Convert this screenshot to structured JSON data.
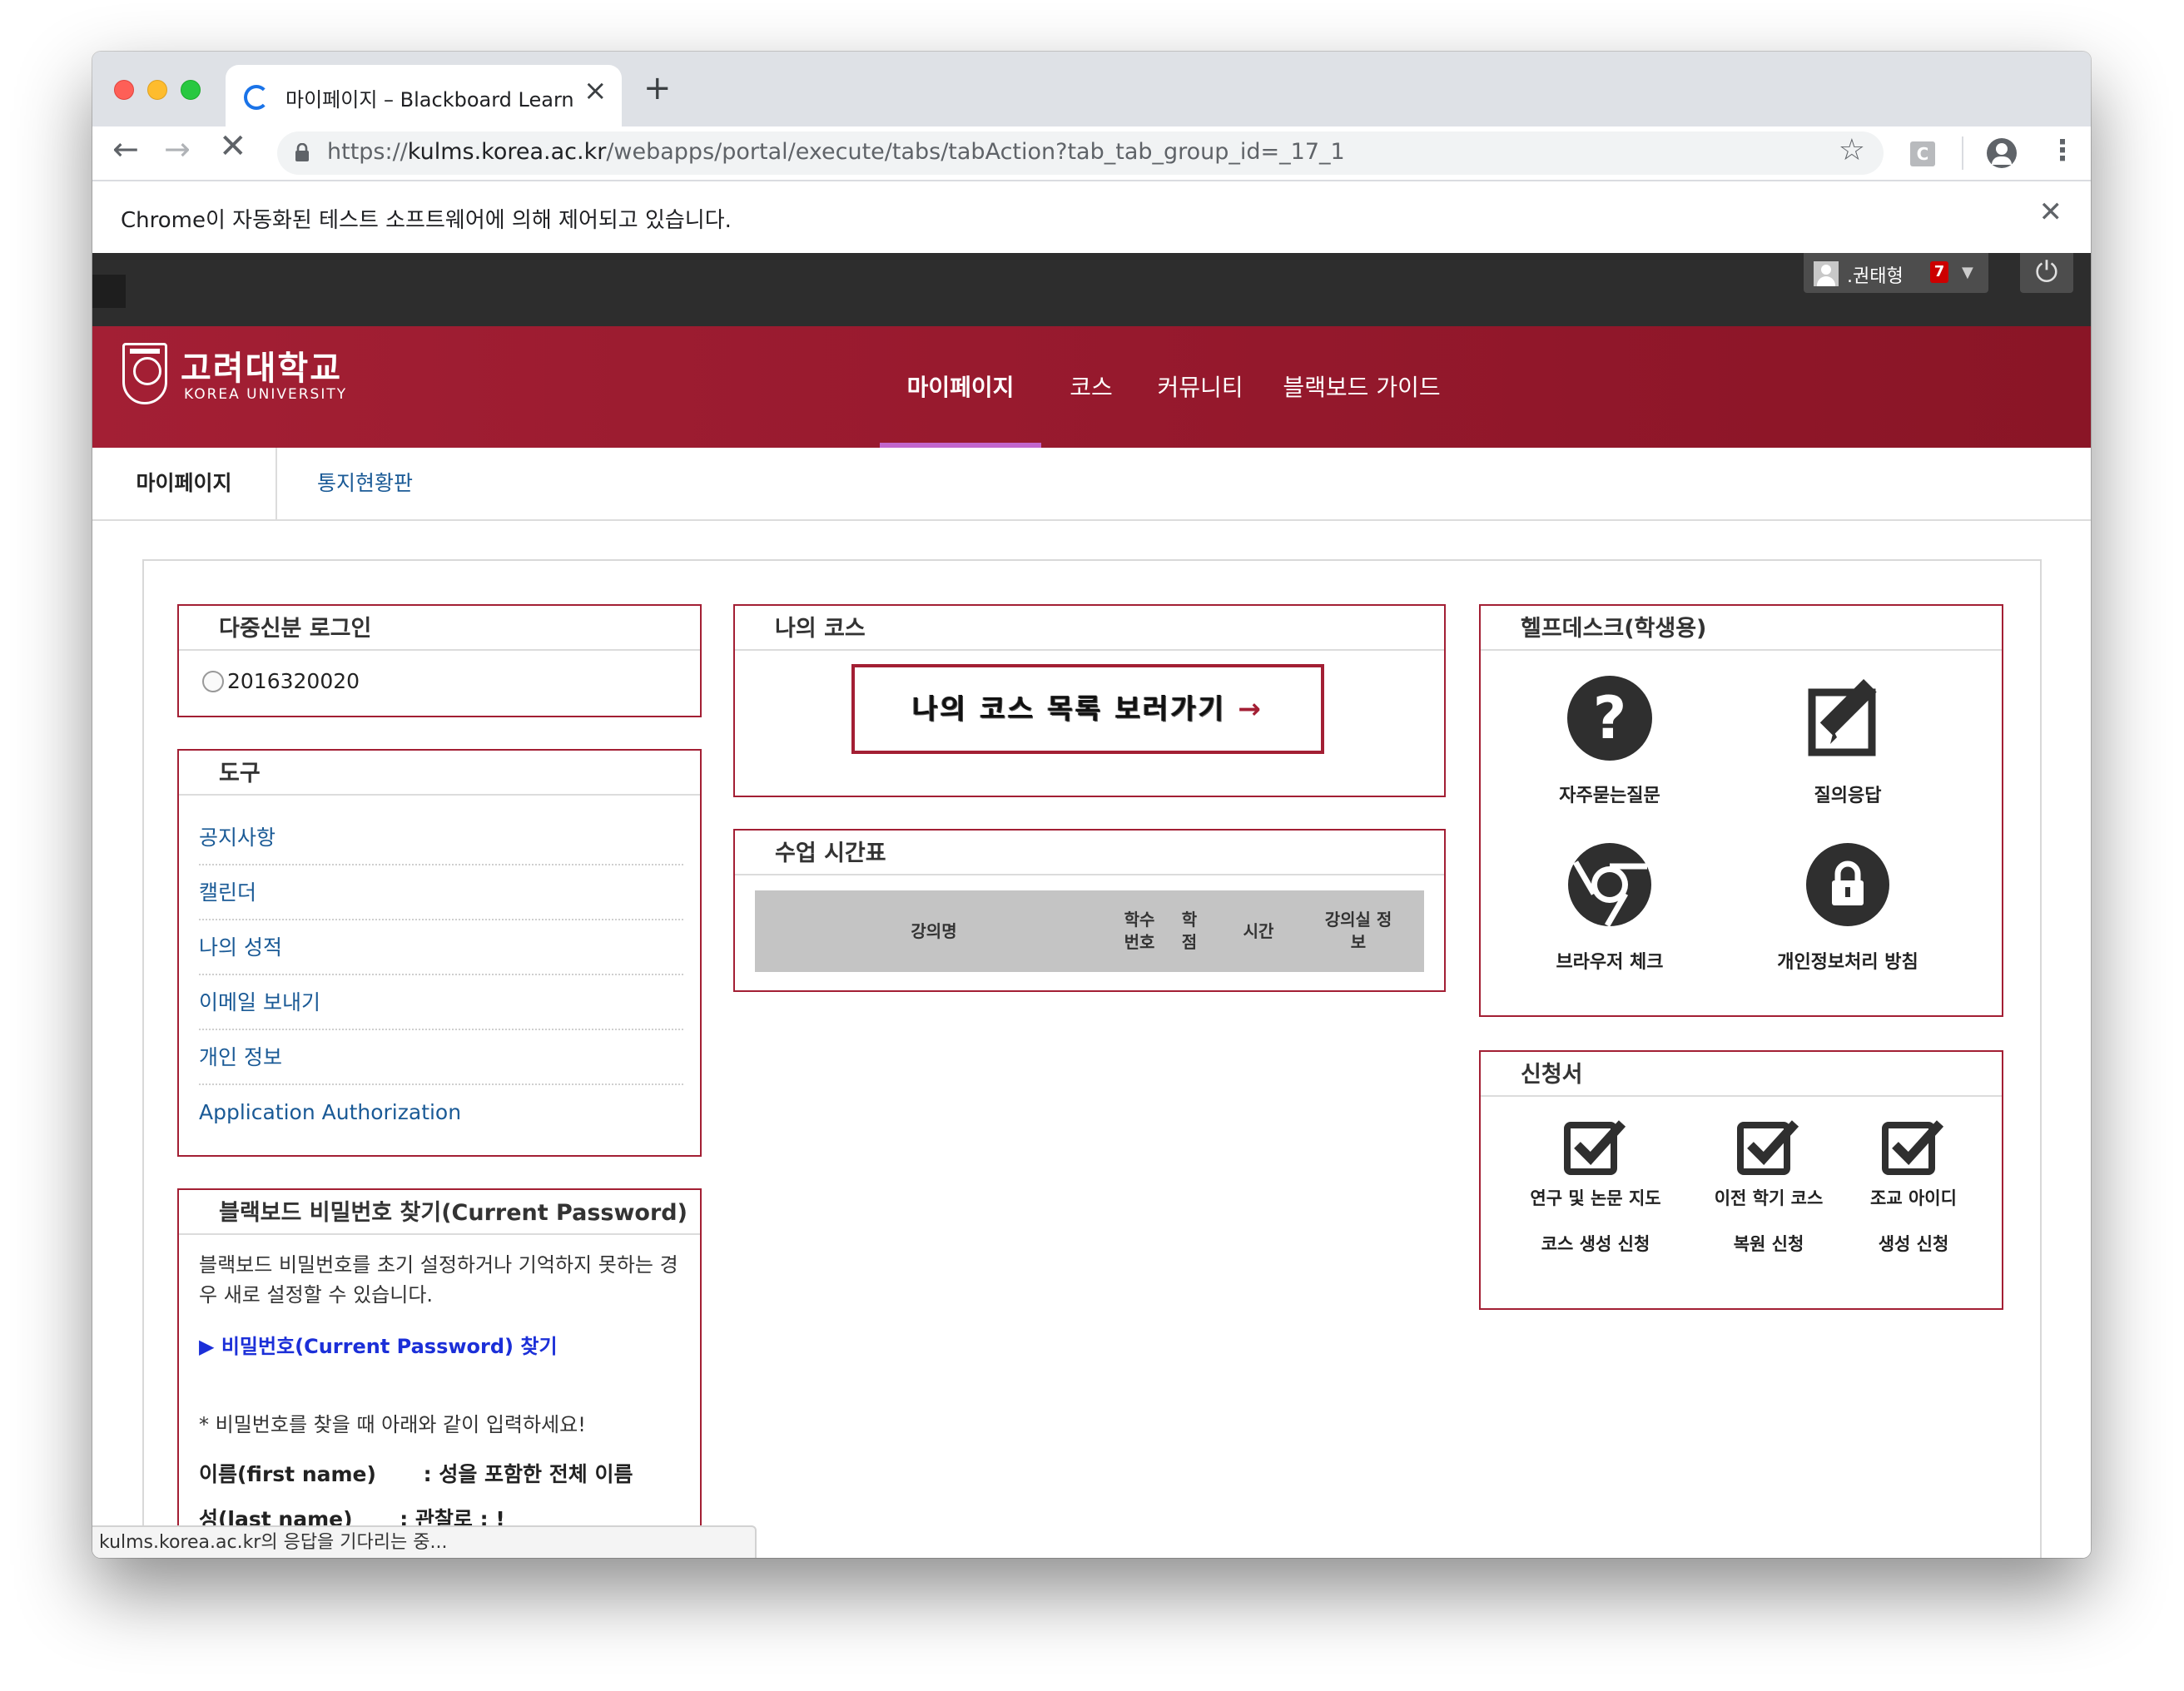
{
  "browser": {
    "tab_title": "마이페이지 – Blackboard Learn",
    "tab_close": "×",
    "new_tab": "+",
    "url_prefix": "https://",
    "url_host": "kulms.korea.ac.kr",
    "url_path": "/webapps/portal/execute/tabs/tabAction?tab_tab_group_id=_17_1",
    "extension_label": "C",
    "infobar_text": "Chrome이 자동화된 테스트 소프트웨어에 의해 제어되고 있습니다.",
    "status_text": "kulms.korea.ac.kr의 응답을 기다리는 중..."
  },
  "topbar": {
    "user_name": ".권태형",
    "notification_count": "7"
  },
  "brand": {
    "name_kr": "고려대학교",
    "name_en": "KOREA UNIVERSITY"
  },
  "main_nav": [
    {
      "label": "마이페이지",
      "active": true
    },
    {
      "label": "코스",
      "active": false
    },
    {
      "label": "커뮤니티",
      "active": false
    },
    {
      "label": "블랙보드 가이드",
      "active": false
    }
  ],
  "sub_nav": {
    "home": "마이페이지",
    "link": "통지현황판"
  },
  "modules": {
    "multi_login": {
      "title": "다중신분 로그인",
      "option": "2016320020"
    },
    "tools": {
      "title": "도구",
      "items": [
        "공지사항",
        "캘린더",
        "나의 성적",
        "이메일 보내기",
        "개인 정보",
        "Application Authorization"
      ]
    },
    "password": {
      "title": "블랙보드 비밀번호 찾기(Current Password)",
      "description": "블랙보드 비밀번호를 초기 설정하거나 기억하지 못하는 경우 새로 설정할 수 있습니다.",
      "link": "▶ 비밀번호(Current Password) 찾기",
      "note": "* 비밀번호를 찾을 때 아래와 같이 입력하세요!",
      "row_label": "이름(first name)",
      "row_value": ": 성을 포함한 전체 이름",
      "row2_label": "성(last name)",
      "row2_value": ": 관찰로 : !"
    },
    "my_courses": {
      "title": "나의 코스",
      "button": "나의 코스 목록 보러가기",
      "arrow": "→"
    },
    "timetable": {
      "title": "수업 시간표",
      "headers": [
        "강의명",
        "학수\n번호",
        "학\n점",
        "시간",
        "강의실 정\n보"
      ]
    },
    "helpdesk": {
      "title": "헬프데스크(학생용)",
      "items": [
        {
          "label": "자주묻는질문",
          "icon": "question-icon"
        },
        {
          "label": "질의응답",
          "icon": "edit-icon"
        },
        {
          "label": "브라우저 체크",
          "icon": "chrome-icon"
        },
        {
          "label": "개인정보처리 방침",
          "icon": "lock-icon"
        }
      ]
    },
    "applications": {
      "title": "신청서",
      "items": [
        {
          "line1": "연구 및 논문 지도",
          "line2": "코스 생성 신청",
          "icon": "checkbox-icon"
        },
        {
          "line1": "이전 학기 코스",
          "line2": "복원 신청",
          "icon": "checkbox-icon"
        },
        {
          "line1": "조교 아이디",
          "line2": "생성 신청",
          "icon": "checkbox-icon"
        }
      ]
    }
  }
}
